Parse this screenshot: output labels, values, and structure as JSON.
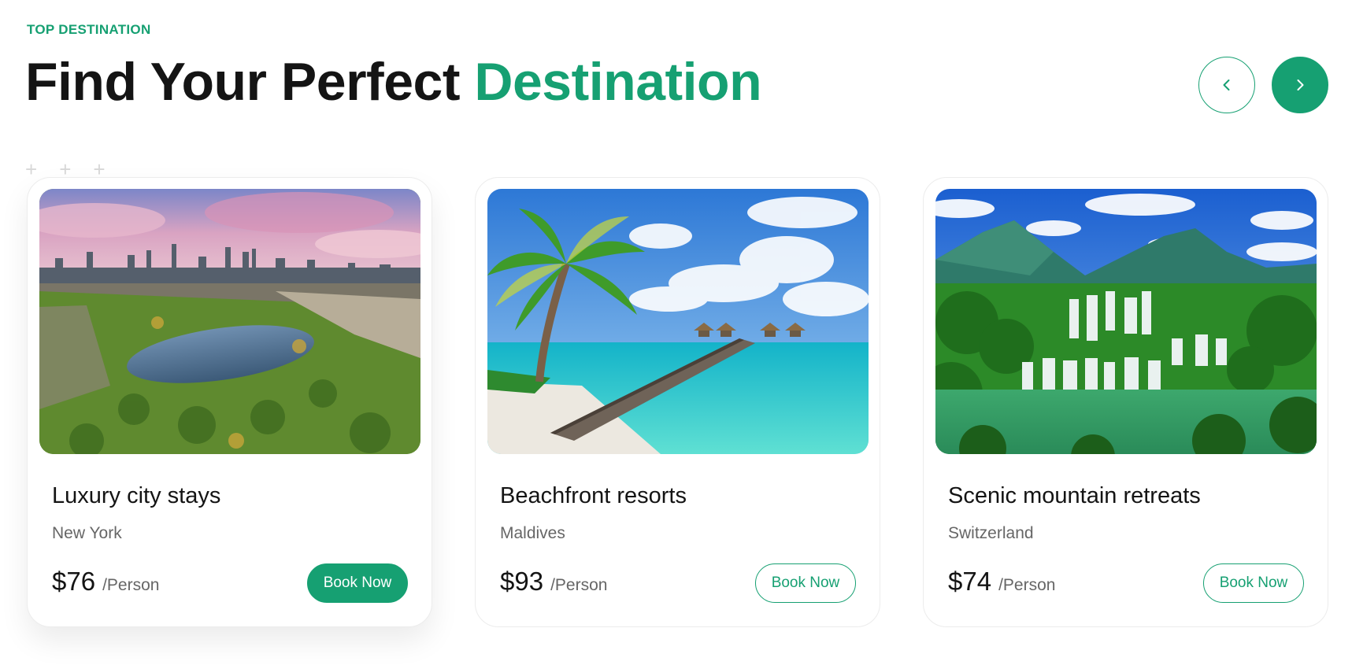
{
  "section": {
    "eyebrow": "TOP DESTINATION",
    "title_main": "Find Your Perfect ",
    "title_accent": "Destination"
  },
  "nav": {
    "prev_icon": "chevron-left-icon",
    "next_icon": "chevron-right-icon"
  },
  "colors": {
    "accent": "#16a072",
    "heading": "#141414",
    "muted": "#666666"
  },
  "cards": [
    {
      "title": "Luxury city stays",
      "location": "New York",
      "price": "$76",
      "unit": "/Person",
      "button": "Book Now",
      "image": "city-park-aerial-image"
    },
    {
      "title": "Beachfront resorts",
      "location": "Maldives",
      "price": "$93",
      "unit": "/Person",
      "button": "Book Now",
      "image": "tropical-pier-image"
    },
    {
      "title": "Scenic mountain retreats",
      "location": "Switzerland",
      "price": "$74",
      "unit": "/Person",
      "button": "Book Now",
      "image": "waterfall-mountains-image"
    }
  ]
}
